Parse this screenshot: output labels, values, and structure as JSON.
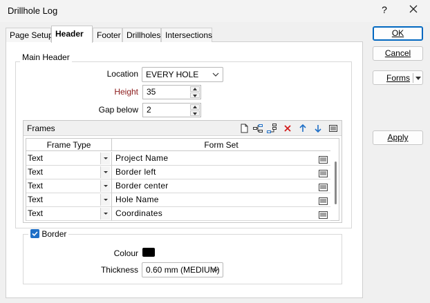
{
  "window": {
    "title": "Drillhole Log",
    "help": "?"
  },
  "tabs": [
    {
      "label": "Page Setup"
    },
    {
      "label": "Header"
    },
    {
      "label": "Footer"
    },
    {
      "label": "Drillholes"
    },
    {
      "label": "Intersections"
    }
  ],
  "buttons": {
    "ok": "OK",
    "cancel": "Cancel",
    "forms": "Forms",
    "apply": "Apply"
  },
  "main_header": {
    "legend": "Main Header",
    "location_label": "Location",
    "location_value": "EVERY HOLE",
    "height_label": "Height",
    "height_value": "35",
    "gap_label": "Gap below",
    "gap_value": "2"
  },
  "frames": {
    "title": "Frames",
    "columns": [
      "Frame Type",
      "Form Set"
    ],
    "rows": [
      {
        "type": "Text",
        "form_set": "Project Name"
      },
      {
        "type": "Text",
        "form_set": "Border left"
      },
      {
        "type": "Text",
        "form_set": "Border center"
      },
      {
        "type": "Text",
        "form_set": "Hole Name"
      },
      {
        "type": "Text",
        "form_set": "Coordinates"
      }
    ]
  },
  "border": {
    "label": "Border",
    "checked": true,
    "colour_label": "Colour",
    "colour_value": "#000000",
    "thickness_label": "Thickness",
    "thickness_value": "0.60 mm (MEDIUM)"
  },
  "colors": {
    "accent": "#0067c0",
    "checkbox": "#1e6fc7",
    "height_label": "#8b1a1a"
  }
}
